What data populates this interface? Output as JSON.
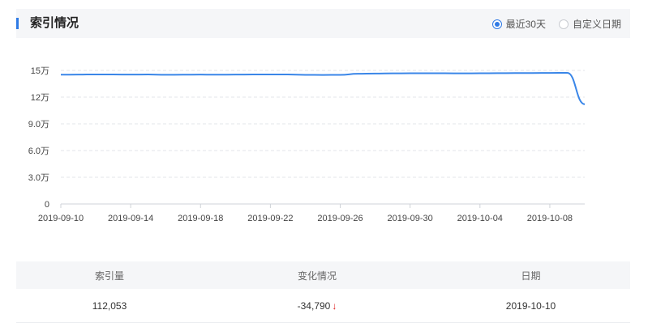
{
  "section": {
    "title": "索引情况"
  },
  "range_options": [
    {
      "label": "最近30天",
      "selected": true
    },
    {
      "label": "自定义日期",
      "selected": false
    }
  ],
  "chart_data": {
    "type": "line",
    "title": "",
    "xlabel": "",
    "ylabel": "",
    "ylim": [
      0,
      150000
    ],
    "y_ticks": [
      0,
      30000,
      60000,
      90000,
      120000,
      150000
    ],
    "y_tick_labels": [
      "0",
      "3.0万",
      "6.0万",
      "9.0万",
      "12万",
      "15万"
    ],
    "x_tick_labels": [
      "2019-09-10",
      "2019-09-14",
      "2019-09-18",
      "2019-09-22",
      "2019-09-26",
      "2019-09-30",
      "2019-10-04",
      "2019-10-08"
    ],
    "grid": true,
    "line_color": "#3a86e8",
    "series": [
      {
        "x": [
          "2019-09-10",
          "2019-09-11",
          "2019-09-12",
          "2019-09-13",
          "2019-09-14",
          "2019-09-15",
          "2019-09-16",
          "2019-09-17",
          "2019-09-18",
          "2019-09-19",
          "2019-09-20",
          "2019-09-21",
          "2019-09-22",
          "2019-09-23",
          "2019-09-24",
          "2019-09-25",
          "2019-09-26",
          "2019-09-27",
          "2019-09-28",
          "2019-09-29",
          "2019-09-30",
          "2019-10-01",
          "2019-10-02",
          "2019-10-03",
          "2019-10-04",
          "2019-10-05",
          "2019-10-06",
          "2019-10-07",
          "2019-10-08",
          "2019-10-09",
          "2019-10-10"
        ],
        "values": [
          145200,
          145300,
          145500,
          145400,
          145300,
          145400,
          145100,
          145200,
          145300,
          145200,
          145300,
          145400,
          145500,
          145400,
          145000,
          144900,
          145000,
          146200,
          146500,
          146700,
          146800,
          146800,
          146800,
          146700,
          146800,
          146900,
          147000,
          147100,
          147200,
          147300,
          112053
        ]
      }
    ]
  },
  "table": {
    "headers": [
      "索引量",
      "变化情况",
      "日期"
    ],
    "row": {
      "index_count": "112,053",
      "change": "-34,790",
      "date": "2019-10-10"
    }
  },
  "colors": {
    "accent": "#2f7ae5",
    "down": "#e02020"
  }
}
